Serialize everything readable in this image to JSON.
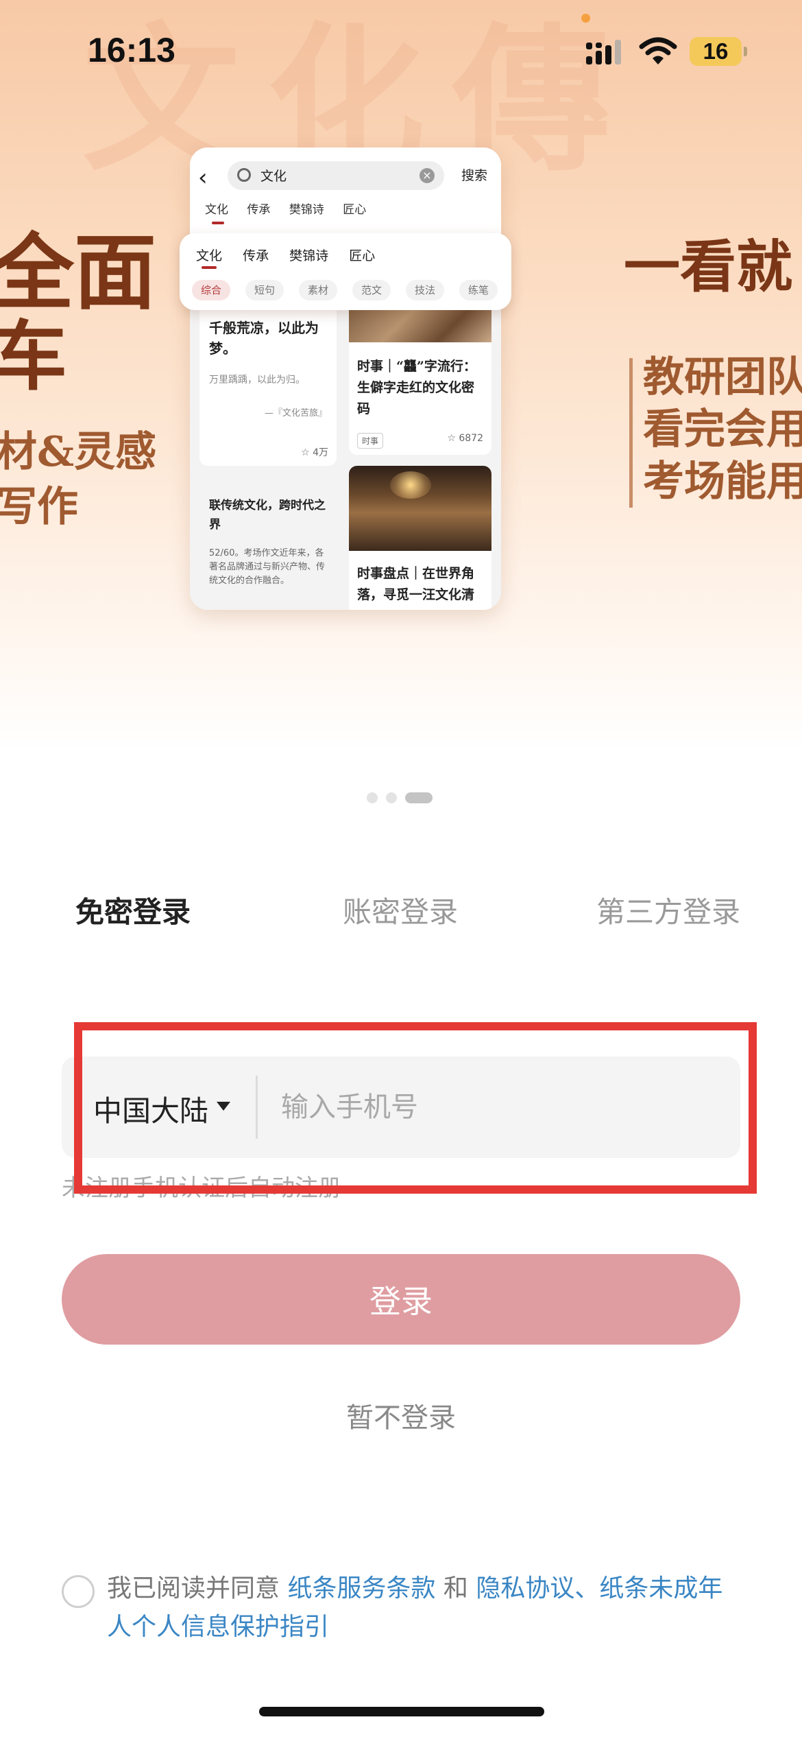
{
  "status_bar": {
    "time": "16:13",
    "battery_level": "16",
    "icons": [
      "signal-icon",
      "wifi-icon",
      "battery-icon"
    ]
  },
  "banner": {
    "left_promo": {
      "line1": "全面",
      "line2": "车",
      "line3": "材&灵感",
      "line4": "写作"
    },
    "right_promo": {
      "title": "一看就",
      "lines": [
        "教研团队",
        "看完会用",
        "考场能用"
      ]
    },
    "mockup": {
      "search_query": "文化",
      "search_button": "搜索",
      "tabs": [
        "文化",
        "传承",
        "樊锦诗",
        "匠心"
      ],
      "filter_chips": [
        "综合",
        "短句",
        "素材",
        "范文",
        "技法",
        "练笔"
      ],
      "active_chip": "综合",
      "cards": [
        {
          "title": "千般荒凉，以此为梦。",
          "subtitle": "万里踽踽，以此为归。",
          "author": "—『文化苦旅』",
          "count": "☆ 4万"
        },
        {
          "title": "时事｜“龘”字流行：生僻字走红的文化密码",
          "tag": "时事",
          "count": "☆ 6872"
        },
        {
          "title": "联传统文化，跨时代之界",
          "subtitle": "52/60。考场作文近年来，各著名品牌通过与新兴产物、传统文化的合作融合。"
        },
        {
          "title": "时事盘点｜在世界角落，寻觅一汪文化清"
        }
      ]
    },
    "page_indicator": {
      "count": 3,
      "active_index": 2
    }
  },
  "login": {
    "tabs": [
      "免密登录",
      "账密登录",
      "第三方登录"
    ],
    "active_tab": "免密登录",
    "region": "中国大陆",
    "phone_placeholder": "输入手机号",
    "phone_value": "",
    "hint": "未注册手机认证后自动注册",
    "login_button": "登录",
    "skip_link": "暂不登录",
    "agreement": {
      "prefix": "我已阅读并同意 ",
      "terms": "纸条服务条款",
      "and": " 和 ",
      "privacy": "隐私协议、纸条未成年人个人信息保护指引"
    },
    "highlight_color": "#e53935",
    "button_color": "#df9da1",
    "link_color": "#3a86c4"
  }
}
